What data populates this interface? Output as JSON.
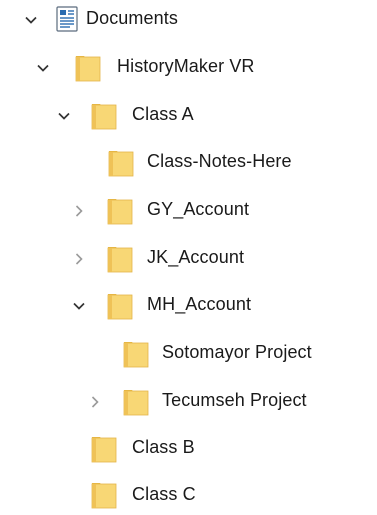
{
  "tree": {
    "items": [
      {
        "label": "Documents",
        "icon": "documents-library-icon",
        "expander": "expanded"
      },
      {
        "label": "HistoryMaker VR",
        "icon": "folder-icon",
        "expander": "expanded"
      },
      {
        "label": "Class A",
        "icon": "folder-icon",
        "expander": "expanded"
      },
      {
        "label": "Class-Notes-Here",
        "icon": "folder-icon",
        "expander": "none"
      },
      {
        "label": "GY_Account",
        "icon": "folder-icon",
        "expander": "collapsed"
      },
      {
        "label": "JK_Account",
        "icon": "folder-icon",
        "expander": "collapsed"
      },
      {
        "label": "MH_Account",
        "icon": "folder-icon",
        "expander": "expanded"
      },
      {
        "label": "Sotomayor Project",
        "icon": "folder-icon",
        "expander": "none"
      },
      {
        "label": "Tecumseh Project",
        "icon": "folder-icon",
        "expander": "collapsed"
      },
      {
        "label": "Class B",
        "icon": "folder-icon",
        "expander": "none"
      },
      {
        "label": "Class C",
        "icon": "folder-icon",
        "expander": "none"
      }
    ]
  },
  "colors": {
    "folder_body": "#F8D775",
    "folder_back": "#E8B740",
    "chevron_expanded": "#333333",
    "chevron_collapsed": "#9A9A9A",
    "text": "#1A1A1A",
    "library_blue": "#2B6CB0"
  }
}
